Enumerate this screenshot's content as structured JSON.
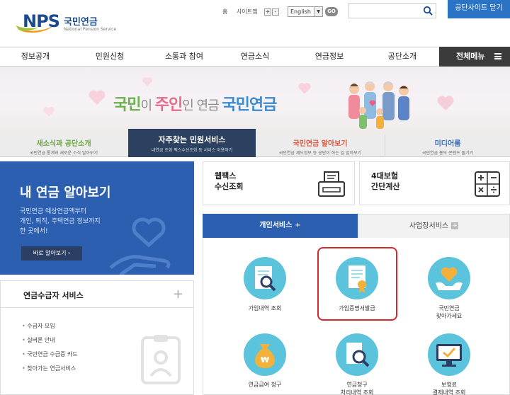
{
  "header": {
    "logo_text": "NPS",
    "logo_korean": "국민연금",
    "logo_english": "National Pension Service",
    "util_home": "홈",
    "util_sitemap": "사이트맵",
    "font_plus": "+",
    "font_minus": "-",
    "language_selected": "English",
    "go_label": "GO",
    "close_site_label": "공단사이트 닫기"
  },
  "nav": {
    "items": [
      "정보공개",
      "민원신청",
      "소통과 참여",
      "연금소식",
      "연금정보",
      "공단소개"
    ],
    "all_menu_label": "전체메뉴"
  },
  "banner": {
    "slogan_part1": "국민",
    "slogan_part2": "이 ",
    "slogan_part3": "주인",
    "slogan_part4": "인 연금 ",
    "slogan_part5": "국민연금"
  },
  "service_tabs": [
    {
      "title": "새소식과 공단소개",
      "sub": "국민연금 통계와 새로운 소식 알아보기",
      "color": "#6aa83a"
    },
    {
      "title": "자주찾는 민원서비스",
      "sub": "내연금 조회 팩스수신조회 등 서비스 이용하기",
      "color": "#ffffff"
    },
    {
      "title": "국민연금 알아보기",
      "sub": "국민연금 제도정보 등 공단이 하는 일 알아보기",
      "color": "#e0583f"
    },
    {
      "title": "미디어룸",
      "sub": "국민연금 홍보 콘텐츠 즐기기",
      "color": "#3d6fbf"
    }
  ],
  "left_panel": {
    "title": "내 연금 알아보기",
    "desc_line1": "국민연금 예상연금액부터",
    "desc_line2": "개인, 퇴직, 주택연금 정보까지",
    "desc_line3": "한 곳에서!",
    "button_label": "바로 알아보기 ›",
    "section_title": "연금수급자 서비스",
    "section_plus": "+",
    "list": [
      "수급자 모임",
      "실버론 안내",
      "국민연금 수급증 카드",
      "찾아가는 연금서비스"
    ]
  },
  "quick": [
    {
      "line1": "웹팩스",
      "line2": "수신조회",
      "icon": "fax-icon"
    },
    {
      "line1": "4대보험",
      "line2": "간단계산",
      "icon": "calculator-icon"
    }
  ],
  "content_tabs": {
    "active": "개인서비스",
    "active_plus": "+",
    "inactive": "사업장서비스",
    "inactive_plus": "+"
  },
  "services": [
    {
      "label": "가입내역 조회",
      "icon": "document-search-icon"
    },
    {
      "label": "가입증명서발급",
      "icon": "certificate-icon"
    },
    {
      "label_line1": "국민연금",
      "label_line2": "찾아가세요",
      "icon": "heart-hands-icon"
    },
    {
      "label": "연금급여 청구",
      "icon": "money-bag-icon"
    },
    {
      "label_line1": "연금청구",
      "label_line2": "처리내역 조회",
      "icon": "magnifier-icon"
    },
    {
      "label_line1": "보험료",
      "label_line2": "결제내역 조회",
      "icon": "monitor-check-icon"
    }
  ]
}
